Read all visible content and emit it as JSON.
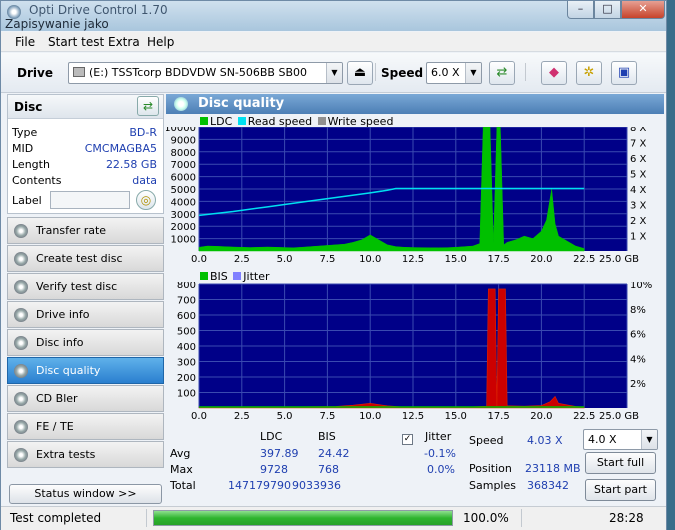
{
  "window": {
    "title": "Opti Drive Control 1.70",
    "subtitle": "Zapisywanie jako",
    "min": "–",
    "max": "□",
    "close": "✕"
  },
  "menu": {
    "file": "File",
    "start_test": "Start test",
    "extra": "Extra",
    "help": "Help"
  },
  "toolbar": {
    "drive_label": "Drive",
    "drive_value": "(E:)   TSSTcorp BDDVDW SN-506BB SB00",
    "speed_label": "Speed",
    "speed_value": "6.0 X"
  },
  "disc": {
    "title": "Disc",
    "rows": [
      {
        "label": "Type",
        "value": "BD-R"
      },
      {
        "label": "MID",
        "value": "CMCMAGBA5"
      },
      {
        "label": "Length",
        "value": "22.58 GB"
      },
      {
        "label": "Contents",
        "value": "data"
      }
    ],
    "label_field": "Label"
  },
  "nav": [
    {
      "label": "Transfer rate"
    },
    {
      "label": "Create test disc"
    },
    {
      "label": "Verify test disc"
    },
    {
      "label": "Drive info"
    },
    {
      "label": "Disc info"
    },
    {
      "label": "Disc quality",
      "active": true
    },
    {
      "label": "CD Bler"
    },
    {
      "label": "FE / TE"
    },
    {
      "label": "Extra tests"
    }
  ],
  "status_window": "Status window >>",
  "panel": {
    "title": "Disc quality"
  },
  "chart_data": [
    {
      "type": "area",
      "legend": [
        "LDC",
        "Read speed",
        "Write speed"
      ],
      "colors": {
        "LDC": "#00c000",
        "Read speed": "#00e0f0",
        "Write speed": "#909090"
      },
      "xlim": [
        0,
        25
      ],
      "ylim": [
        0,
        10000
      ],
      "x_ticks": [
        "0.0",
        "2.5",
        "5.0",
        "7.5",
        "10.0",
        "12.5",
        "15.0",
        "17.5",
        "20.0",
        "22.5",
        "25.0 GB"
      ],
      "y_ticks": [
        "10000",
        "9000",
        "8000",
        "7000",
        "6000",
        "5000",
        "4000",
        "3000",
        "2000",
        "1000"
      ],
      "y2_ticks": [
        "8 X",
        "7 X",
        "6 X",
        "5 X",
        "4 X",
        "3 X",
        "2 X",
        "1 X"
      ],
      "ldc_x": [
        0,
        0.5,
        1,
        1.5,
        2,
        2.5,
        3,
        3.5,
        4,
        4.5,
        5,
        5.5,
        6,
        6.5,
        7,
        7.5,
        8,
        8.5,
        9,
        9.5,
        10,
        10.5,
        11,
        11.5,
        12,
        12.5,
        13,
        13.5,
        14,
        14.5,
        15,
        15.5,
        16,
        16.4,
        16.6,
        17.0,
        17.2,
        17.4,
        17.6,
        17.8,
        18,
        18.5,
        19,
        19.5,
        20,
        20.3,
        20.6,
        20.8,
        21,
        21.5,
        22,
        22.5
      ],
      "ldc_y": [
        300,
        400,
        380,
        350,
        320,
        300,
        280,
        300,
        320,
        300,
        280,
        260,
        300,
        350,
        400,
        450,
        500,
        550,
        700,
        900,
        1300,
        900,
        500,
        350,
        300,
        280,
        270,
        260,
        260,
        270,
        300,
        350,
        400,
        600,
        10000,
        10000,
        600,
        10000,
        10000,
        500,
        700,
        900,
        1200,
        1000,
        1600,
        2500,
        5000,
        2200,
        1200,
        800,
        400,
        200
      ],
      "read_speed_x": [
        0,
        2,
        4,
        6,
        8,
        10,
        11,
        11.5,
        12,
        14,
        16,
        17,
        18,
        19,
        20,
        21,
        22,
        22.5
      ],
      "read_speed_y": [
        2.3,
        2.55,
        2.85,
        3.15,
        3.45,
        3.75,
        3.92,
        4.03,
        4.03,
        4.03,
        4.03,
        4.03,
        4.03,
        4.03,
        4.03,
        4.03,
        4.03,
        4.03
      ]
    },
    {
      "type": "area",
      "legend": [
        "BIS",
        "Jitter"
      ],
      "colors": {
        "BIS": "#00c000",
        "Jitter": "#8080ff"
      },
      "xlim": [
        0,
        25
      ],
      "ylim": [
        0,
        800
      ],
      "x_ticks": [
        "0.0",
        "2.5",
        "5.0",
        "7.5",
        "10.0",
        "12.5",
        "15.0",
        "17.5",
        "20.0",
        "22.5",
        "25.0 GB"
      ],
      "y_ticks": [
        "800",
        "700",
        "600",
        "500",
        "400",
        "300",
        "200",
        "100"
      ],
      "y2_ticks": [
        "10%",
        "8%",
        "6%",
        "4%",
        "2%"
      ],
      "bis_x": [
        0,
        2,
        4,
        6,
        8,
        9,
        10,
        11,
        12,
        14,
        16,
        16.8,
        16.9,
        17.3,
        17.4,
        17.5,
        17.9,
        18,
        19,
        20,
        20.5,
        20.8,
        21,
        22,
        22.5
      ],
      "bis_y": [
        4,
        5,
        6,
        8,
        10,
        18,
        30,
        14,
        6,
        5,
        8,
        12,
        768,
        768,
        12,
        768,
        768,
        14,
        12,
        16,
        40,
        75,
        30,
        10,
        6
      ]
    }
  ],
  "stats": {
    "headers": {
      "ldc": "LDC",
      "bis": "BIS",
      "jitter": "Jitter"
    },
    "avg": {
      "label": "Avg",
      "ldc": "397.89",
      "bis": "24.42",
      "jitter": "-0.1%"
    },
    "max": {
      "label": "Max",
      "ldc": "9728",
      "bis": "768",
      "jitter": "0.0%"
    },
    "total": {
      "label": "Total",
      "ldc": "147179790",
      "bis": "9033936"
    },
    "speed_label": "Speed",
    "speed_value": "4.03 X",
    "speed_select": "4.0 X",
    "position_label": "Position",
    "position_value": "23118 MB",
    "samples_label": "Samples",
    "samples_value": "368342",
    "start_full": "Start full",
    "start_part": "Start part"
  },
  "statusbar": {
    "text": "Test completed",
    "progress": 100.0,
    "progress_text": "100.0%",
    "time": "28:28"
  }
}
